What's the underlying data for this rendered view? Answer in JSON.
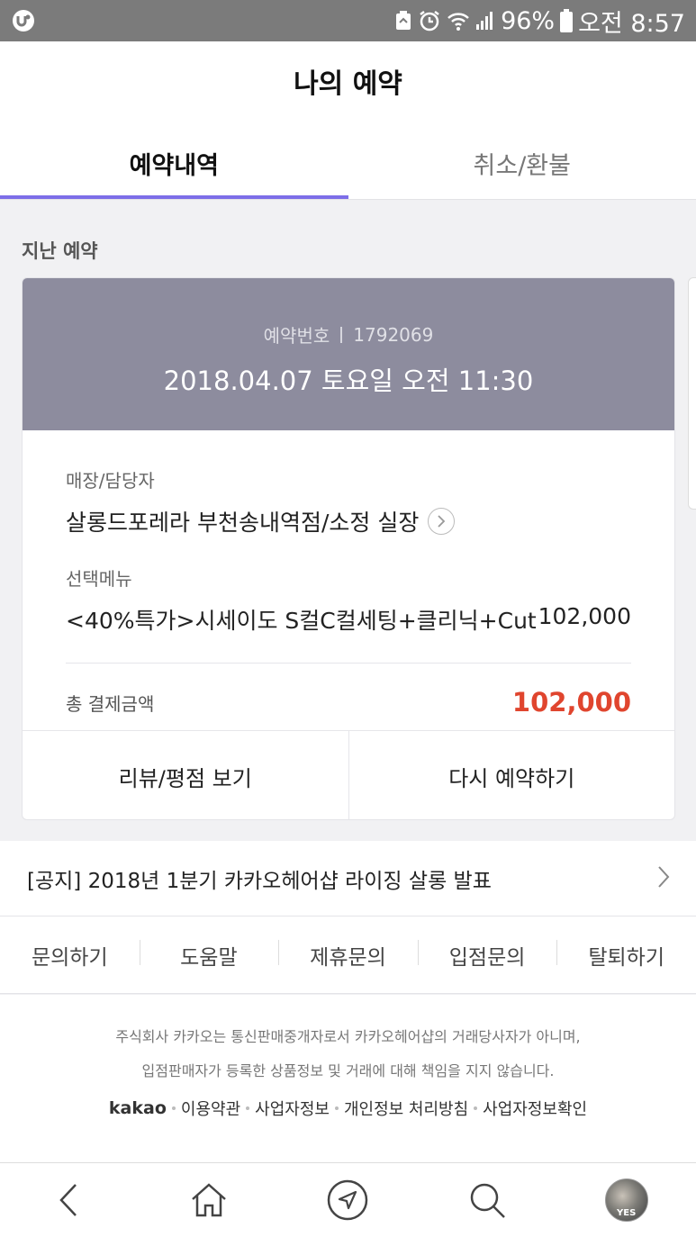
{
  "status_bar": {
    "battery": "96%",
    "time": "오전 8:57"
  },
  "header": {
    "title": "나의 예약",
    "tabs": [
      {
        "label": "예약내역",
        "active": true
      },
      {
        "label": "취소/환불",
        "active": false
      }
    ],
    "accent_color": "#7d6ee8"
  },
  "section_label": "지난 예약",
  "reservation": {
    "number_label": "예약번호",
    "number": "1792069",
    "datetime": "2018.04.07 토요일 오전 11:30",
    "store_label": "매장/담당자",
    "store_value": "살롱드포레라 부천송내역점/소정 실장",
    "menu_label": "선택메뉴",
    "menu_name": "<40%특가>시세이도 S컬C컬세팅+클리닉+Cut",
    "menu_price": "102,000",
    "total_label": "총 결제금액",
    "total_value": "102,000",
    "total_color": "#e0452e",
    "actions": {
      "review": "리뷰/평점 보기",
      "rebook": "다시 예약하기"
    }
  },
  "notice": {
    "text": "[공지] 2018년 1분기 카카오헤어샵 라이징 살롱 발표"
  },
  "footer_links": [
    "문의하기",
    "도움말",
    "제휴문의",
    "입점문의",
    "탈퇴하기"
  ],
  "disclaimer": {
    "line1": "주식회사 카카오는 통신판매중개자로서 카카오헤어샵의 거래당사자가 아니며,",
    "line2": "입점판매자가 등록한 상품정보 및 거래에 대해 책임을 지지 않습니다.",
    "brand": "kakao",
    "links": [
      "이용약관",
      "사업자정보",
      "개인정보 처리방침",
      "사업자정보확인"
    ]
  },
  "bottom_nav": {
    "icons": [
      "back-icon",
      "home-icon",
      "navigate-icon",
      "search-icon",
      "avatar"
    ],
    "avatar_text": "YES"
  }
}
